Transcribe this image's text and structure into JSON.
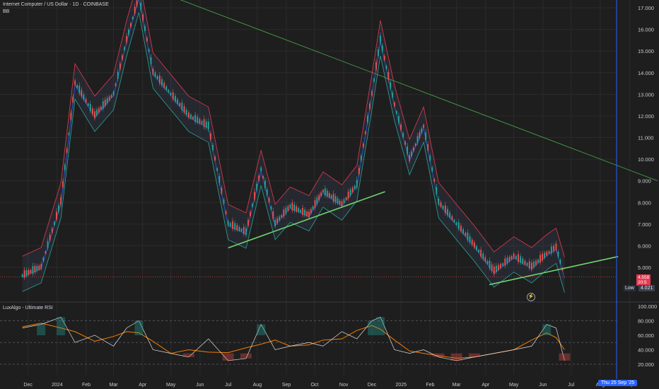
{
  "header": {
    "symbol_title": "Internet Computer / US Dollar · 1D · COINBASE",
    "bb_label": "BB"
  },
  "indicator": {
    "rsi_title": "LuxAlgo - Ultimate RSI"
  },
  "colors": {
    "background": "#1e1e1e",
    "grid": "#2b2b2b",
    "bull_candle": "#26a69a",
    "bear_candle": "#ef5350",
    "bb_upper": "#e53950",
    "bb_lower": "#26a69a",
    "bb_mid": "#2962ff",
    "trendline_green": "#6fd46f",
    "trendline_down": "#4caf50",
    "rsi_line": "#e0e0e0",
    "rsi_signal": "#f57c00",
    "crosshair_blue": "#2962ff"
  },
  "price_axis": {
    "ticks": [
      "17.000",
      "16.000",
      "15.000",
      "14.000",
      "13.000",
      "12.000",
      "11.000",
      "10.000",
      "9.000",
      "8.000",
      "7.000",
      "6.000",
      "5.000"
    ],
    "current_price_top": "4.558",
    "current_price_bottom": "20:5"
  },
  "rsi_axis": {
    "ticks": [
      "100.000",
      "80.000",
      "60.000",
      "40.000",
      "20.000"
    ]
  },
  "time_axis": {
    "labels": [
      "Dec",
      "2024",
      "Feb",
      "Mar",
      "Apr",
      "May",
      "Jun",
      "Jul",
      "Aug",
      "Sep",
      "Oct",
      "Nov",
      "Dec",
      "2025",
      "Feb",
      "Mar",
      "Apr",
      "May",
      "Jun",
      "Jul",
      "Aug",
      "Sep"
    ],
    "crosshair_date": "Thu 25 Sep '25"
  },
  "low_marker": {
    "label": "Low",
    "value": "4.021"
  },
  "flash_icon": "lightning-icon",
  "chart_data": {
    "type": "line",
    "title": "Internet Computer / US Dollar · 1D · COINBASE",
    "ylim": [
      4.0,
      17.0
    ],
    "close_path_dates": [
      "2023-11-25",
      "2023-12-15",
      "2024-01-05",
      "2024-01-20",
      "2024-02-10",
      "2024-03-01",
      "2024-03-15",
      "2024-03-28",
      "2024-04-12",
      "2024-05-01",
      "2024-05-20",
      "2024-06-10",
      "2024-07-01",
      "2024-07-20",
      "2024-08-05",
      "2024-08-20",
      "2024-09-05",
      "2024-09-25",
      "2024-10-10",
      "2024-10-30",
      "2024-11-15",
      "2024-12-01",
      "2024-12-10",
      "2024-12-25",
      "2025-01-10",
      "2025-01-25",
      "2025-02-10",
      "2025-03-01",
      "2025-03-20",
      "2025-04-10",
      "2025-05-01",
      "2025-05-20",
      "2025-06-05",
      "2025-06-15",
      "2025-06-24"
    ],
    "close_values": [
      4.6,
      5.0,
      8.0,
      13.5,
      12.0,
      13.0,
      15.5,
      17.5,
      14.0,
      13.0,
      12.0,
      11.5,
      7.0,
      6.6,
      9.5,
      7.0,
      7.8,
      7.4,
      8.5,
      7.9,
      8.8,
      13.0,
      15.5,
      12.5,
      10.0,
      11.5,
      8.0,
      7.0,
      6.0,
      4.8,
      5.5,
      5.0,
      5.6,
      5.9,
      4.56
    ],
    "rsi_values": [
      70,
      75,
      85,
      50,
      60,
      45,
      70,
      80,
      40,
      35,
      30,
      55,
      25,
      28,
      75,
      40,
      45,
      50,
      45,
      65,
      55,
      80,
      85,
      40,
      35,
      40,
      30,
      25,
      30,
      35,
      40,
      45,
      75,
      70,
      25
    ],
    "rsi_ylim": [
      0,
      100
    ],
    "support_lines": [
      {
        "from": [
          "2024-07-01",
          5.9
        ],
        "to": [
          "2024-12-15",
          8.5
        ]
      },
      {
        "from": [
          "2025-04-05",
          4.2
        ],
        "to": [
          "2025-08-20",
          5.5
        ]
      }
    ],
    "resistance_line": {
      "from": [
        "2024-04-15",
        17.8
      ],
      "to": [
        "2025-10-01",
        9.0
      ]
    }
  }
}
